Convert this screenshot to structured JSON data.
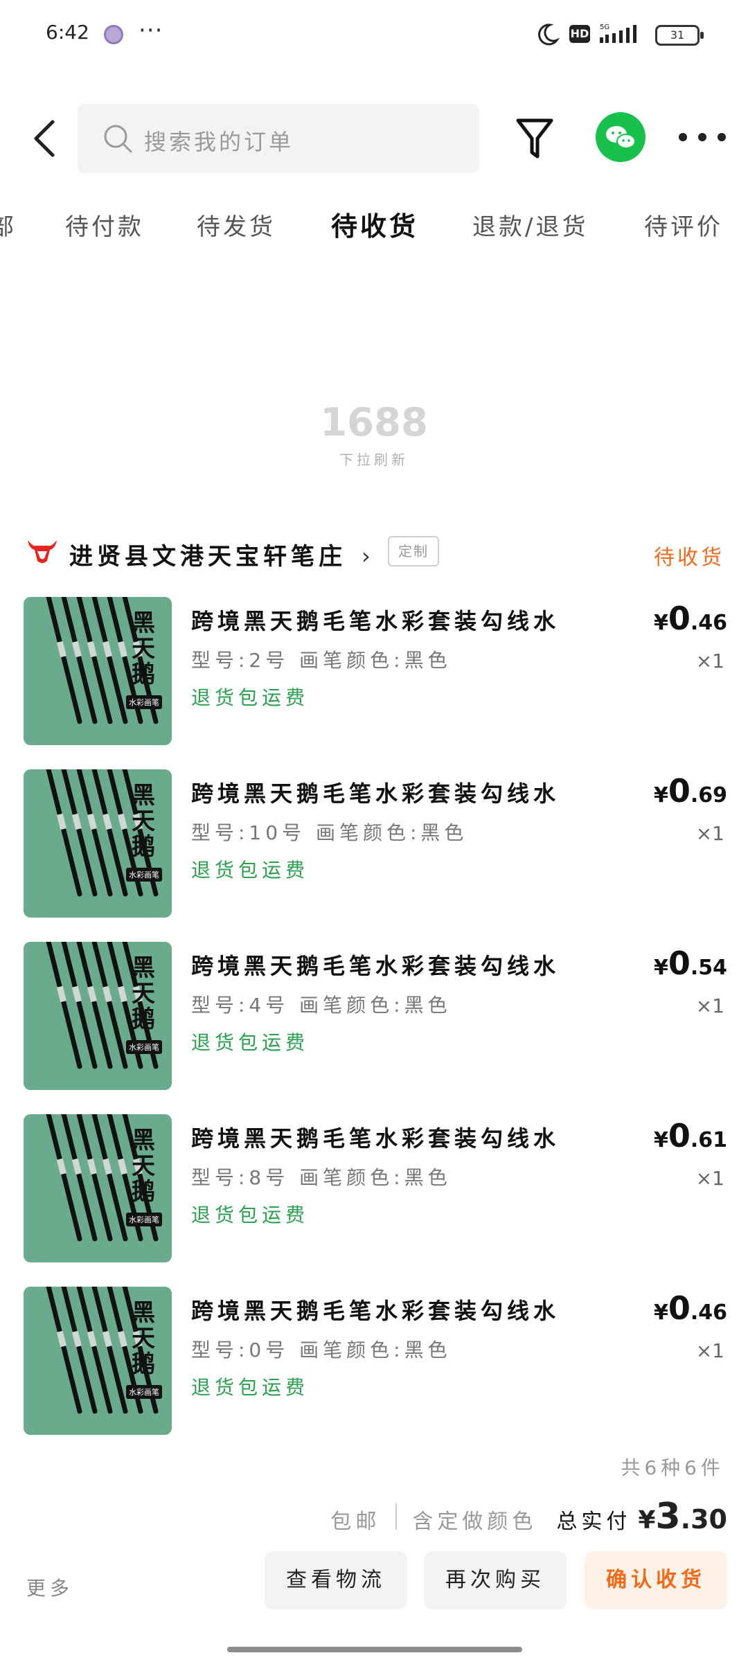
{
  "status_bar": {
    "time": "6:42",
    "dots": "···",
    "network": "5G",
    "hd": "HD",
    "battery": "31"
  },
  "header": {
    "search_placeholder": "搜索我的订单",
    "icons": [
      "back-arrow-icon",
      "search-icon",
      "filter-icon",
      "wechat-icon",
      "more-dots-icon"
    ]
  },
  "tabs": [
    {
      "label": "部"
    },
    {
      "label": "待付款"
    },
    {
      "label": "待发货"
    },
    {
      "label": "待收货",
      "active": true
    },
    {
      "label": "退款/退货"
    },
    {
      "label": "待评价"
    }
  ],
  "refresh": {
    "logo": "1688",
    "hint": "下拉刷新"
  },
  "store": {
    "name": "进贤县文港天宝轩笔庄",
    "tag": "定制",
    "status": "待收货",
    "status_color": "#f46a18"
  },
  "thumbnail": {
    "brand": "黑天鹅",
    "subtitle": "水彩画笔"
  },
  "products": [
    {
      "title": "跨境黑天鹅毛笔水彩套装勾线水",
      "spec": "型号:2号 画笔颜色:黑色",
      "return": "退货包运费",
      "currency": "¥",
      "price_int": "0",
      "price_dec": ".46",
      "qty": "×1"
    },
    {
      "title": "跨境黑天鹅毛笔水彩套装勾线水",
      "spec": "型号:10号 画笔颜色:黑色",
      "return": "退货包运费",
      "currency": "¥",
      "price_int": "0",
      "price_dec": ".69",
      "qty": "×1"
    },
    {
      "title": "跨境黑天鹅毛笔水彩套装勾线水",
      "spec": "型号:4号 画笔颜色:黑色",
      "return": "退货包运费",
      "currency": "¥",
      "price_int": "0",
      "price_dec": ".54",
      "qty": "×1"
    },
    {
      "title": "跨境黑天鹅毛笔水彩套装勾线水",
      "spec": "型号:8号 画笔颜色:黑色",
      "return": "退货包运费",
      "currency": "¥",
      "price_int": "0",
      "price_dec": ".61",
      "qty": "×1"
    },
    {
      "title": "跨境黑天鹅毛笔水彩套装勾线水",
      "spec": "型号:0号 画笔颜色:黑色",
      "return": "退货包运费",
      "currency": "¥",
      "price_int": "0",
      "price_dec": ".46",
      "qty": "×1"
    }
  ],
  "summary": {
    "count": "共6种6件",
    "shipping": "包邮",
    "custom_color": "含定做颜色",
    "paid_label": "总实付",
    "currency": "¥",
    "total_int": "3",
    "total_dec": ".30"
  },
  "actions": {
    "more": "更多",
    "logistics": "查看物流",
    "rebuy": "再次购买",
    "confirm": "确认收货"
  },
  "colors": {
    "accent": "#f46a18",
    "green": "#2aa14f",
    "wechat": "#19c04b"
  }
}
